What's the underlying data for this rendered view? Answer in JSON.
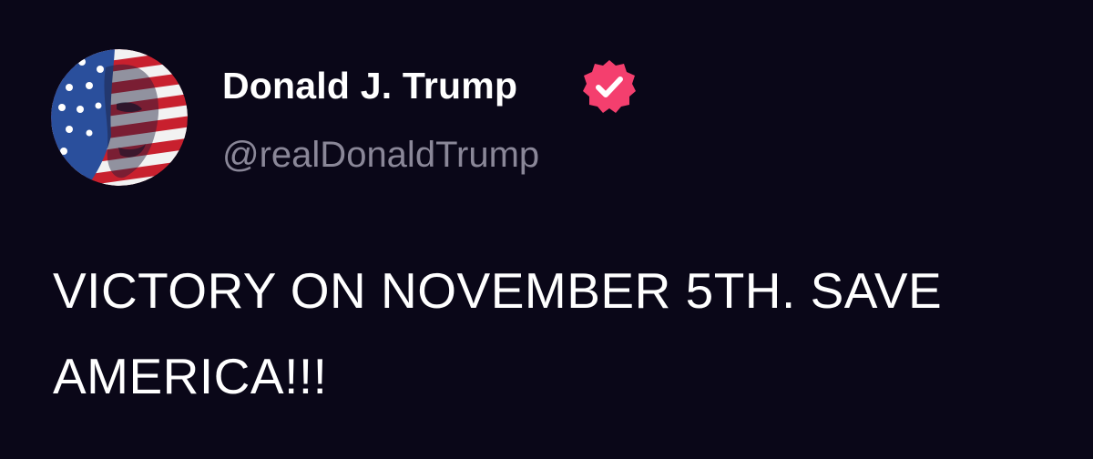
{
  "post": {
    "author": {
      "display_name": "Donald J. Trump",
      "handle": "@realDonaldTrump",
      "verified": true,
      "verified_icon": "verified-badge-icon",
      "verified_color": "#f43f6e",
      "avatar": "profile-avatar-flag-portrait"
    },
    "text": "VICTORY ON NOVEMBER 5TH. SAVE AMERICA!!!"
  },
  "colors": {
    "background": "#0a0718",
    "name": "#ffffff",
    "handle": "#8a8798",
    "text": "#ffffff"
  }
}
